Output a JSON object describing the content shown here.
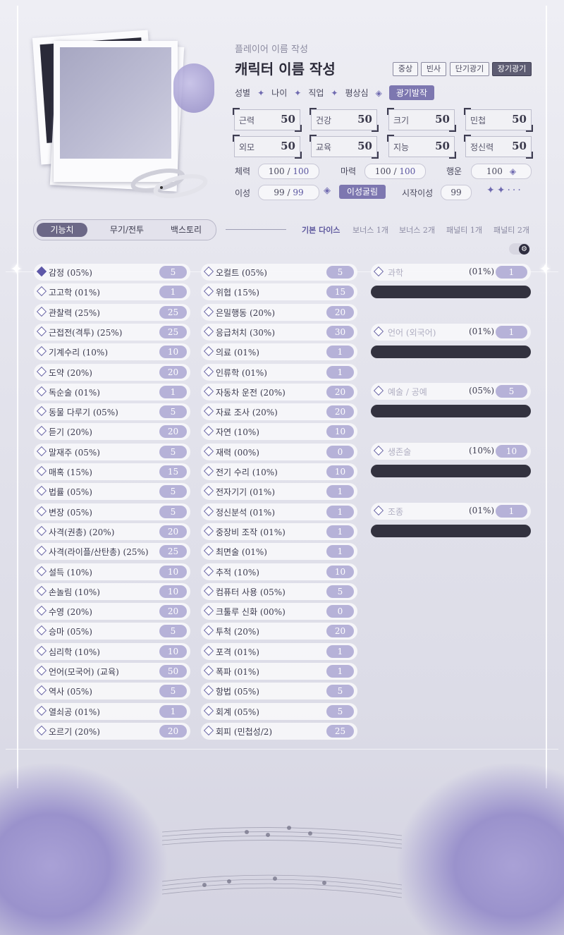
{
  "header": {
    "subtitle": "플레이어 이름 작성",
    "character_name": "캐릭터 이름 작성",
    "modes": [
      "중상",
      "빈사",
      "단기광기",
      "장기광기"
    ],
    "active_mode": "장기광기",
    "tags": [
      "성별",
      "나이",
      "직업",
      "평상심"
    ],
    "madness_badge": "광기발작"
  },
  "stats": [
    {
      "label": "근력",
      "value": "50"
    },
    {
      "label": "건강",
      "value": "50"
    },
    {
      "label": "크기",
      "value": "50"
    },
    {
      "label": "민첩",
      "value": "50"
    },
    {
      "label": "외모",
      "value": "50"
    },
    {
      "label": "교육",
      "value": "50"
    },
    {
      "label": "지능",
      "value": "50"
    },
    {
      "label": "정신력",
      "value": "50"
    }
  ],
  "resources": {
    "hp": {
      "label": "체력",
      "current": "100",
      "max": "100"
    },
    "mp": {
      "label": "마력",
      "current": "100",
      "max": "100"
    },
    "luck": {
      "label": "행운",
      "value": "100"
    },
    "sanity": {
      "label": "이성",
      "current": "99",
      "max": "99"
    },
    "sanity_button": "이성굴림",
    "start_sanity": {
      "label": "시작이성",
      "value": "99"
    },
    "slash": "/"
  },
  "tabs": [
    "기능치",
    "무기/전투",
    "백스토리"
  ],
  "dice_modes": [
    "기본 다이스",
    "보너스 1개",
    "보너스 2개",
    "패널티 1개",
    "패널티 2개"
  ],
  "skills_left": [
    {
      "name": "감정 (05%)",
      "value": "5",
      "checked": true
    },
    {
      "name": "고고학 (01%)",
      "value": "1"
    },
    {
      "name": "관찰력 (25%)",
      "value": "25"
    },
    {
      "name": "근접전(격투) (25%)",
      "value": "25"
    },
    {
      "name": "기계수리 (10%)",
      "value": "10"
    },
    {
      "name": "도약 (20%)",
      "value": "20"
    },
    {
      "name": "독순술 (01%)",
      "value": "1"
    },
    {
      "name": "동물 다루기 (05%)",
      "value": "5"
    },
    {
      "name": "듣기 (20%)",
      "value": "20"
    },
    {
      "name": "말재주 (05%)",
      "value": "5"
    },
    {
      "name": "매혹 (15%)",
      "value": "15"
    },
    {
      "name": "법률 (05%)",
      "value": "5"
    },
    {
      "name": "변장 (05%)",
      "value": "5"
    },
    {
      "name": "사격(권총) (20%)",
      "value": "20"
    },
    {
      "name": "사격(라이플/산탄총) (25%)",
      "value": "25"
    },
    {
      "name": "설득 (10%)",
      "value": "10"
    },
    {
      "name": "손놀림 (10%)",
      "value": "10"
    },
    {
      "name": "수영 (20%)",
      "value": "20"
    },
    {
      "name": "승마 (05%)",
      "value": "5"
    },
    {
      "name": "심리학 (10%)",
      "value": "10"
    },
    {
      "name": "언어(모국어) (교육)",
      "value": "50"
    },
    {
      "name": "역사 (05%)",
      "value": "5"
    },
    {
      "name": "열쇠공 (01%)",
      "value": "1"
    },
    {
      "name": "오르기 (20%)",
      "value": "20"
    }
  ],
  "skills_middle": [
    {
      "name": "오컬트 (05%)",
      "value": "5"
    },
    {
      "name": "위협 (15%)",
      "value": "15"
    },
    {
      "name": "은밀행동 (20%)",
      "value": "20"
    },
    {
      "name": "응급처치 (30%)",
      "value": "30"
    },
    {
      "name": "의료 (01%)",
      "value": "1"
    },
    {
      "name": "인류학 (01%)",
      "value": "1"
    },
    {
      "name": "자동차 운전 (20%)",
      "value": "20"
    },
    {
      "name": "자료 조사 (20%)",
      "value": "20"
    },
    {
      "name": "자연 (10%)",
      "value": "10"
    },
    {
      "name": "재력 (00%)",
      "value": "0"
    },
    {
      "name": "전기 수리 (10%)",
      "value": "10"
    },
    {
      "name": "전자기기 (01%)",
      "value": "1"
    },
    {
      "name": "정신분석 (01%)",
      "value": "1"
    },
    {
      "name": "중장비 조작 (01%)",
      "value": "1"
    },
    {
      "name": "최면술 (01%)",
      "value": "1"
    },
    {
      "name": "추적 (10%)",
      "value": "10"
    },
    {
      "name": "컴퓨터 사용 (05%)",
      "value": "5"
    },
    {
      "name": "크툴루 신화 (00%)",
      "value": "0"
    },
    {
      "name": "투척 (20%)",
      "value": "20"
    },
    {
      "name": "포격 (01%)",
      "value": "1"
    },
    {
      "name": "폭파 (01%)",
      "value": "1"
    },
    {
      "name": "항법 (05%)",
      "value": "5"
    },
    {
      "name": "회계 (05%)",
      "value": "5"
    },
    {
      "name": "회피 (민첩성/2)",
      "value": "25"
    }
  ],
  "skills_right": [
    {
      "name": "과학",
      "percent": "(01%)",
      "value": "1"
    },
    {
      "name": "언어 (외국어)",
      "percent": "(01%)",
      "value": "1"
    },
    {
      "name": "예술 / 공예",
      "percent": "(05%)",
      "value": "5"
    },
    {
      "name": "생존술",
      "percent": "(10%)",
      "value": "10"
    },
    {
      "name": "조종",
      "percent": "(01%)",
      "value": "1"
    }
  ]
}
